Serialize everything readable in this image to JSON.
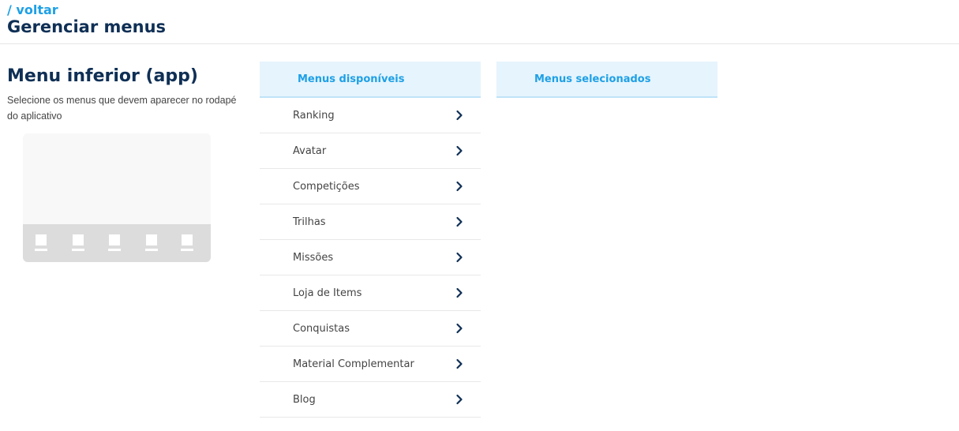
{
  "header": {
    "back_link": "/ voltar",
    "title": "Gerenciar menus"
  },
  "section": {
    "title": "Menu inferior (app)",
    "description": "Selecione os menus que devem aparecer no rodapé do aplicativo"
  },
  "available_panel": {
    "title": "Menus disponíveis",
    "items": [
      {
        "label": "Ranking"
      },
      {
        "label": "Avatar"
      },
      {
        "label": "Competições"
      },
      {
        "label": "Trilhas"
      },
      {
        "label": "Missões"
      },
      {
        "label": "Loja de Items"
      },
      {
        "label": "Conquistas"
      },
      {
        "label": "Material Complementar"
      },
      {
        "label": "Blog"
      }
    ]
  },
  "selected_panel": {
    "title": "Menus selecionados",
    "items": []
  },
  "phone_preview": {
    "slot_count": 5
  },
  "colors": {
    "accent": "#1ea0e6",
    "title": "#0f2f55",
    "panel_header_bg": "#e6f4fd",
    "chevron": "#0f2f55"
  },
  "icons": {
    "menu_item_action": "chevron-right-icon"
  }
}
